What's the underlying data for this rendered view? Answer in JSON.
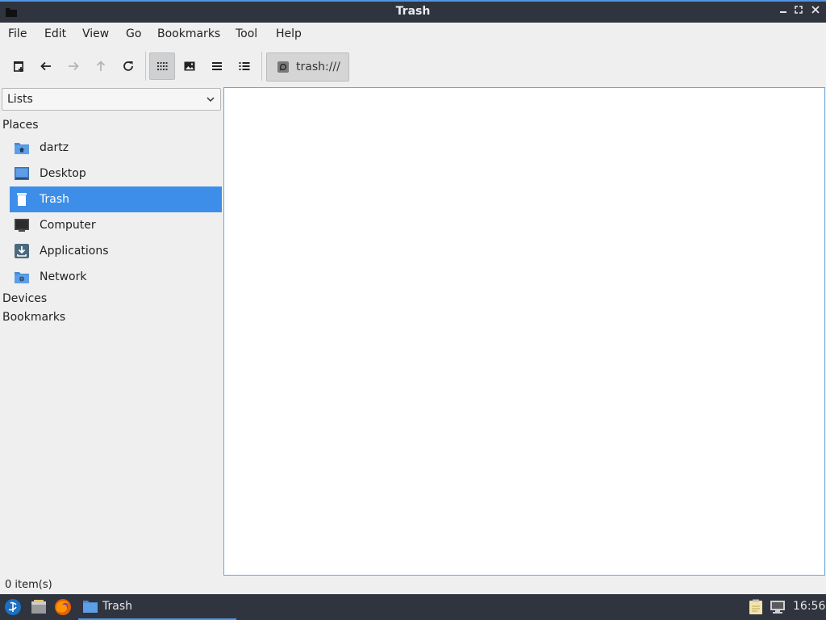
{
  "window": {
    "title": "Trash",
    "minimize_icon": "minimize-icon",
    "maximize_icon": "maximize-icon",
    "close_icon": "close-icon"
  },
  "menubar": {
    "items": [
      "File",
      "Edit",
      "View",
      "Go",
      "Bookmarks",
      "Tool",
      "Help"
    ]
  },
  "toolbar": {
    "buttons": [
      "new-tab-icon",
      "back-icon",
      "forward-icon",
      "up-icon",
      "reload-icon",
      "icon-view-icon",
      "thumbnail-view-icon",
      "compact-view-icon",
      "detailed-list-view-icon"
    ],
    "active_view": "icon-view",
    "location": "trash:///"
  },
  "sidebar": {
    "mode": "Lists",
    "sections": {
      "places": "Places",
      "devices": "Devices",
      "bookmarks": "Bookmarks"
    },
    "items": [
      {
        "label": "dartz",
        "icon": "home-folder-icon"
      },
      {
        "label": "Desktop",
        "icon": "desktop-icon"
      },
      {
        "label": "Trash",
        "icon": "trash-icon",
        "selected": true
      },
      {
        "label": "Computer",
        "icon": "computer-icon"
      },
      {
        "label": "Applications",
        "icon": "applications-icon"
      },
      {
        "label": "Network",
        "icon": "network-icon"
      }
    ]
  },
  "status": {
    "text": "0 item(s)"
  },
  "taskbar": {
    "launchers": [
      "start-menu-icon",
      "file-manager-icon",
      "firefox-icon"
    ],
    "task_label": "Trash",
    "tray": [
      "clipboard-icon",
      "network-status-icon"
    ],
    "clock": "16:56"
  },
  "colors": {
    "accent": "#3c8ee8",
    "titlebar": "#2f343f",
    "border_focus": "#6ea5d8"
  }
}
